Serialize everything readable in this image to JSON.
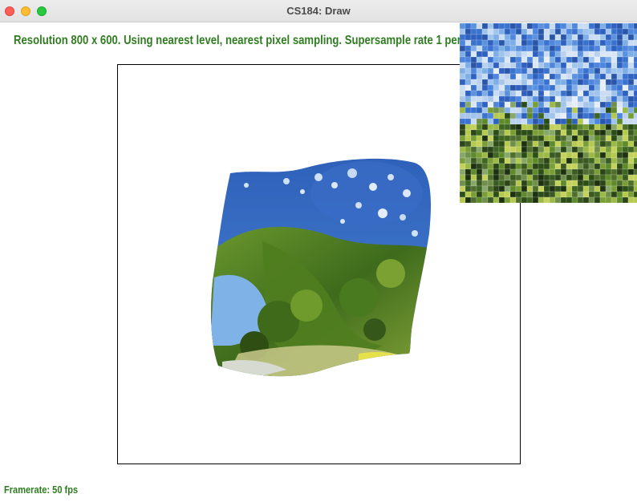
{
  "window": {
    "title": "CS184: Draw"
  },
  "status": {
    "message": "Resolution 800 x 600. Using nearest level, nearest pixel sampling. Supersample rate 1 per pixel.",
    "framerate": "Framerate: 50 fps"
  },
  "colors": {
    "status_text": "#2f7d20",
    "sky": "#3b6fc4",
    "foliage": "#5d8a22"
  },
  "icons": {
    "close": "close-icon",
    "minimize": "minimize-icon",
    "maximize": "maximize-icon"
  }
}
